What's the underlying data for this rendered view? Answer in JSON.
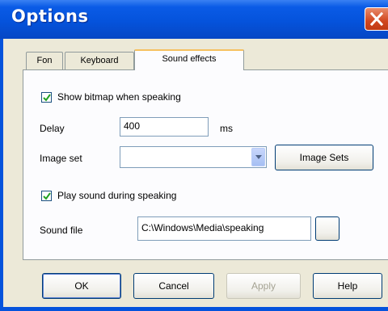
{
  "window": {
    "title": "Options",
    "close_icon": "close-icon"
  },
  "tabs": [
    {
      "label": "Fon",
      "active": false
    },
    {
      "label": "Keyboard",
      "active": false
    },
    {
      "label": "Sound effects",
      "active": true
    }
  ],
  "panel": {
    "show_bitmap_checkbox": {
      "label": "Show bitmap when speaking",
      "checked": true
    },
    "delay": {
      "label": "Delay",
      "value": "400",
      "unit": "ms"
    },
    "image_set": {
      "label": "Image set",
      "value": "",
      "button": "Image Sets"
    },
    "play_sound_checkbox": {
      "label": "Play sound during speaking",
      "checked": true
    },
    "sound_file": {
      "label": "Sound file",
      "value": "C:\\Windows\\Media\\speaking",
      "browse_label": ""
    }
  },
  "buttons": {
    "ok": "OK",
    "cancel": "Cancel",
    "apply": "Apply",
    "help": "Help"
  }
}
